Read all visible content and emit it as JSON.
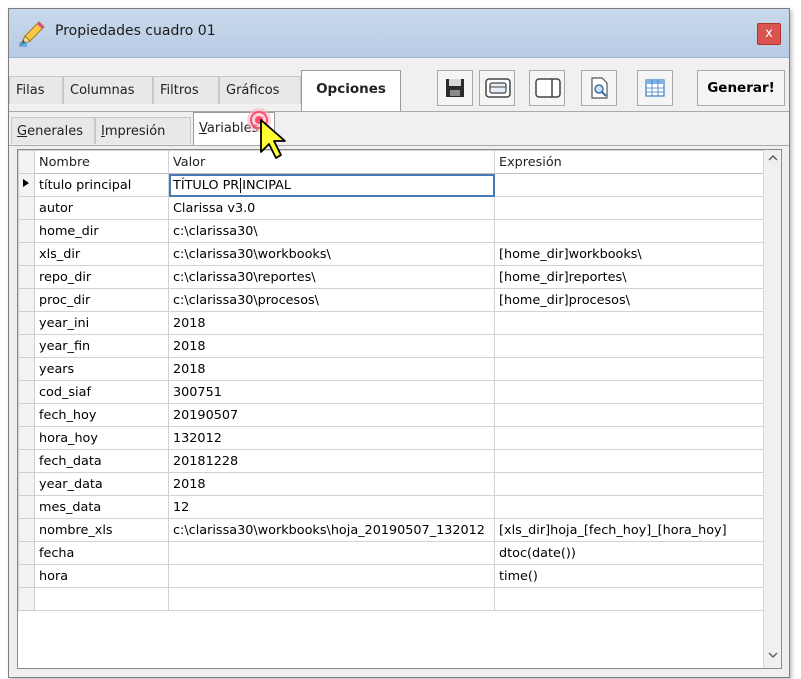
{
  "window": {
    "title": "Propiedades cuadro 01",
    "close_label": "x"
  },
  "tabs": [
    {
      "label": "Filas"
    },
    {
      "label": "Columnas"
    },
    {
      "label": "Filtros"
    },
    {
      "label": "Gráficos"
    },
    {
      "label": "Opciones",
      "active": true
    }
  ],
  "toolbar": {
    "icons": [
      "save-icon",
      "layout-panel-icon",
      "split-view-icon",
      "preview-icon",
      "grid-icon"
    ],
    "generar_label": "Generar!"
  },
  "subtabs": [
    {
      "label": "Generales"
    },
    {
      "label": "Impresión"
    },
    {
      "label": "Variables",
      "active": true
    }
  ],
  "grid": {
    "columns": [
      "Nombre",
      "Valor",
      "Expresión"
    ],
    "rows": [
      {
        "nombre": "título principal",
        "valor_before": "TÍTULO PR",
        "valor_after": "INCIPAL",
        "expresion": ""
      },
      {
        "nombre": "autor",
        "valor": "Clarissa v3.0",
        "expresion": ""
      },
      {
        "nombre": "home_dir",
        "valor": "c:\\clarissa30\\",
        "expresion": ""
      },
      {
        "nombre": "xls_dir",
        "valor": "c:\\clarissa30\\workbooks\\",
        "expresion": "[home_dir]workbooks\\"
      },
      {
        "nombre": "repo_dir",
        "valor": "c:\\clarissa30\\reportes\\",
        "expresion": "[home_dir]reportes\\"
      },
      {
        "nombre": "proc_dir",
        "valor": "c:\\clarissa30\\procesos\\",
        "expresion": "[home_dir]procesos\\"
      },
      {
        "nombre": "year_ini",
        "valor": "2018",
        "expresion": ""
      },
      {
        "nombre": "year_fin",
        "valor": "2018",
        "expresion": ""
      },
      {
        "nombre": "years",
        "valor": "2018",
        "expresion": ""
      },
      {
        "nombre": "cod_siaf",
        "valor": "300751",
        "expresion": ""
      },
      {
        "nombre": "fech_hoy",
        "valor": "20190507",
        "expresion": ""
      },
      {
        "nombre": "hora_hoy",
        "valor": "132012",
        "expresion": ""
      },
      {
        "nombre": "fech_data",
        "valor": "20181228",
        "expresion": ""
      },
      {
        "nombre": "year_data",
        "valor": "2018",
        "expresion": ""
      },
      {
        "nombre": "mes_data",
        "valor": "12",
        "expresion": ""
      },
      {
        "nombre": "nombre_xls",
        "valor": "c:\\clarissa30\\workbooks\\hoja_20190507_132012",
        "expresion": "[xls_dir]hoja_[fech_hoy]_[hora_hoy]"
      },
      {
        "nombre": "fecha",
        "valor": "",
        "expresion": "dtoc(date())"
      },
      {
        "nombre": "hora",
        "valor": "",
        "expresion": "time()"
      }
    ]
  },
  "colors": {
    "titlebar": "#c9d9ec",
    "close": "#d9534f",
    "edit_border": "#4a7ab5",
    "cursor_fill": "#ffff33",
    "click_ring": "#ff4d6d"
  }
}
